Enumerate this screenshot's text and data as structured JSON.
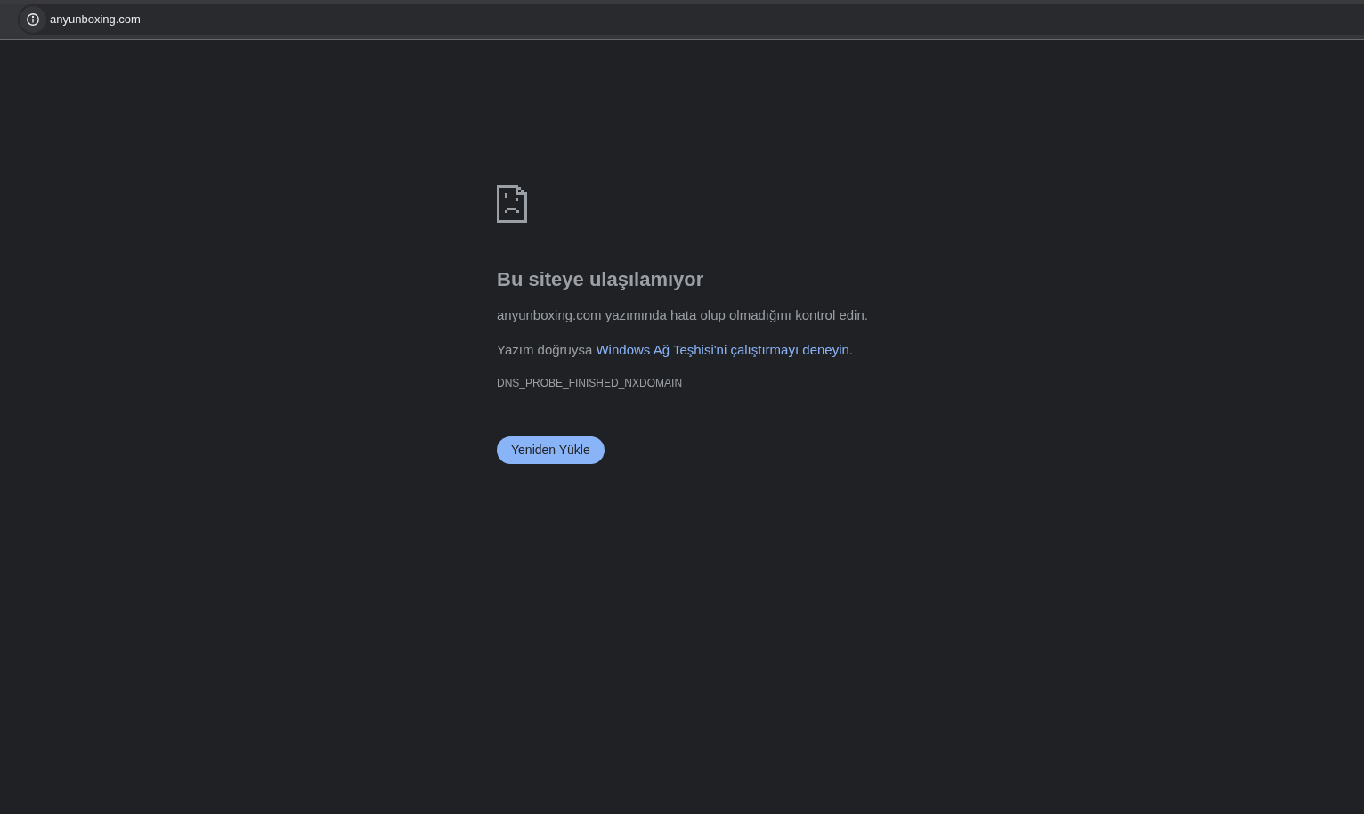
{
  "address_bar": {
    "url": "anyunboxing.com"
  },
  "error_page": {
    "title": "Bu siteye ulaşılamıyor",
    "message": "anyunboxing.com yazımında hata olup olmadığını kontrol edin.",
    "suggestion": {
      "prefix": "Yazım doğruysa",
      "link": "Windows Ağ Teşhisi'ni çalıştırmayı deneyin",
      "suffix": "."
    },
    "error_code": "DNS_PROBE_FINISHED_NXDOMAIN",
    "buttons": [
      "Yeniden Yükle"
    ]
  }
}
